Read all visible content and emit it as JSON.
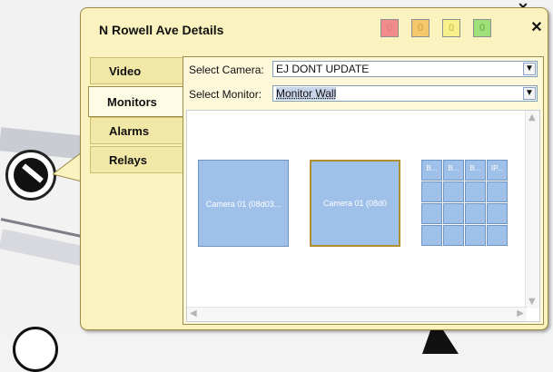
{
  "window_close": "✕",
  "popup": {
    "title": "N Rowell Ave Details",
    "status_boxes": [
      {
        "value": "0",
        "color": "#f28c8c",
        "text_color": "#d47d7d"
      },
      {
        "value": "0",
        "color": "#f5c96a",
        "text_color": "#c99b39"
      },
      {
        "value": "0",
        "color": "#f8f08a",
        "text_color": "#c7b73d"
      },
      {
        "value": "0",
        "color": "#9fe07b",
        "text_color": "#5ea63a"
      }
    ],
    "close": "✕"
  },
  "tabs": [
    {
      "label": "Video"
    },
    {
      "label": "Monitors"
    },
    {
      "label": "Alarms"
    },
    {
      "label": "Relays"
    }
  ],
  "active_tab": "Monitors",
  "camera": {
    "label": "Select Camera:",
    "value": "EJ DONT UPDATE"
  },
  "monitor": {
    "label": "Select Monitor:",
    "value": "Monitor Wall"
  },
  "monitors": [
    {
      "label": "Camera 01 (08d03...",
      "selected": false
    },
    {
      "label": "Camera 01 (08d0",
      "selected": true
    }
  ],
  "grid_cells": [
    "B...",
    "B...",
    "B...",
    "IP..."
  ],
  "icons": {
    "dropdown": "chevron-down-icon",
    "scroll_up": "scroll-up-arrow-icon",
    "scroll_down": "scroll-down-arrow-icon",
    "scroll_left": "scroll-left-arrow-icon",
    "scroll_right": "scroll-right-arrow-icon"
  }
}
